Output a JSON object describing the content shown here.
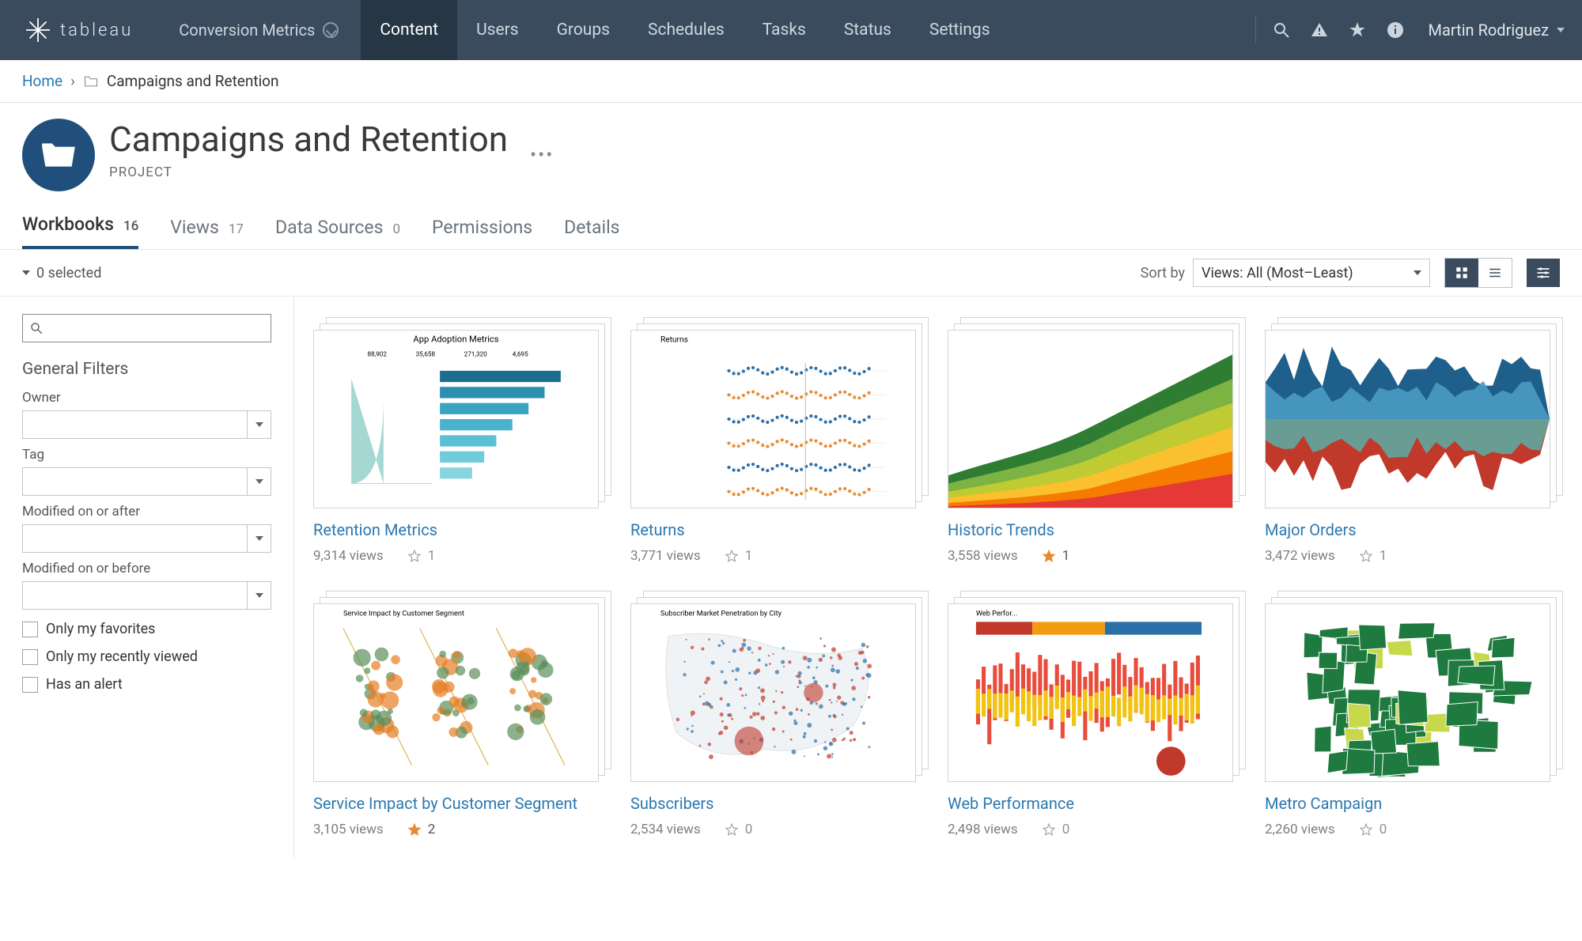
{
  "brand": "tableau",
  "site_picker": "Conversion Metrics",
  "nav": {
    "items": [
      "Content",
      "Users",
      "Groups",
      "Schedules",
      "Tasks",
      "Status",
      "Settings"
    ],
    "active": "Content"
  },
  "user": "Martin Rodriguez",
  "breadcrumb": {
    "home": "Home",
    "project": "Campaigns and Retention"
  },
  "project": {
    "title": "Campaigns and Retention",
    "subtitle": "PROJECT"
  },
  "tabs": [
    {
      "label": "Workbooks",
      "count": "16",
      "active": true
    },
    {
      "label": "Views",
      "count": "17",
      "active": false
    },
    {
      "label": "Data Sources",
      "count": "0",
      "active": false
    },
    {
      "label": "Permissions",
      "count": "",
      "active": false
    },
    {
      "label": "Details",
      "count": "",
      "active": false
    }
  ],
  "toolbar": {
    "selected": "0 selected",
    "sortby_label": "Sort by",
    "sort_value": "Views: All (Most–Least)"
  },
  "sidebar": {
    "general_filters": "General Filters",
    "owner": "Owner",
    "tag": "Tag",
    "mod_after": "Modified on or after",
    "mod_before": "Modified on or before",
    "only_fav": "Only my favorites",
    "only_recent": "Only my recently viewed",
    "has_alert": "Has an alert"
  },
  "cards": [
    {
      "title": "Retention Metrics",
      "views": "9,314 views",
      "favcount": "1",
      "fav": false,
      "thumb_title": "App Adoption Metrics"
    },
    {
      "title": "Returns",
      "views": "3,771 views",
      "favcount": "1",
      "fav": false,
      "thumb_title": "Returns"
    },
    {
      "title": "Historic Trends",
      "views": "3,558 views",
      "favcount": "1",
      "fav": true,
      "thumb_title": ""
    },
    {
      "title": "Major Orders",
      "views": "3,472 views",
      "favcount": "1",
      "fav": false,
      "thumb_title": ""
    },
    {
      "title": "Service Impact by Customer Segment",
      "views": "3,105 views",
      "favcount": "2",
      "fav": true,
      "thumb_title": "Service Impact by Customer Segment"
    },
    {
      "title": "Subscribers",
      "views": "2,534 views",
      "favcount": "0",
      "fav": false,
      "thumb_title": "Subscriber Market Penetration by City"
    },
    {
      "title": "Web Performance",
      "views": "2,498 views",
      "favcount": "0",
      "fav": false,
      "thumb_title": "Web Perfor..."
    },
    {
      "title": "Metro Campaign",
      "views": "2,260 views",
      "favcount": "0",
      "fav": false,
      "thumb_title": ""
    }
  ]
}
